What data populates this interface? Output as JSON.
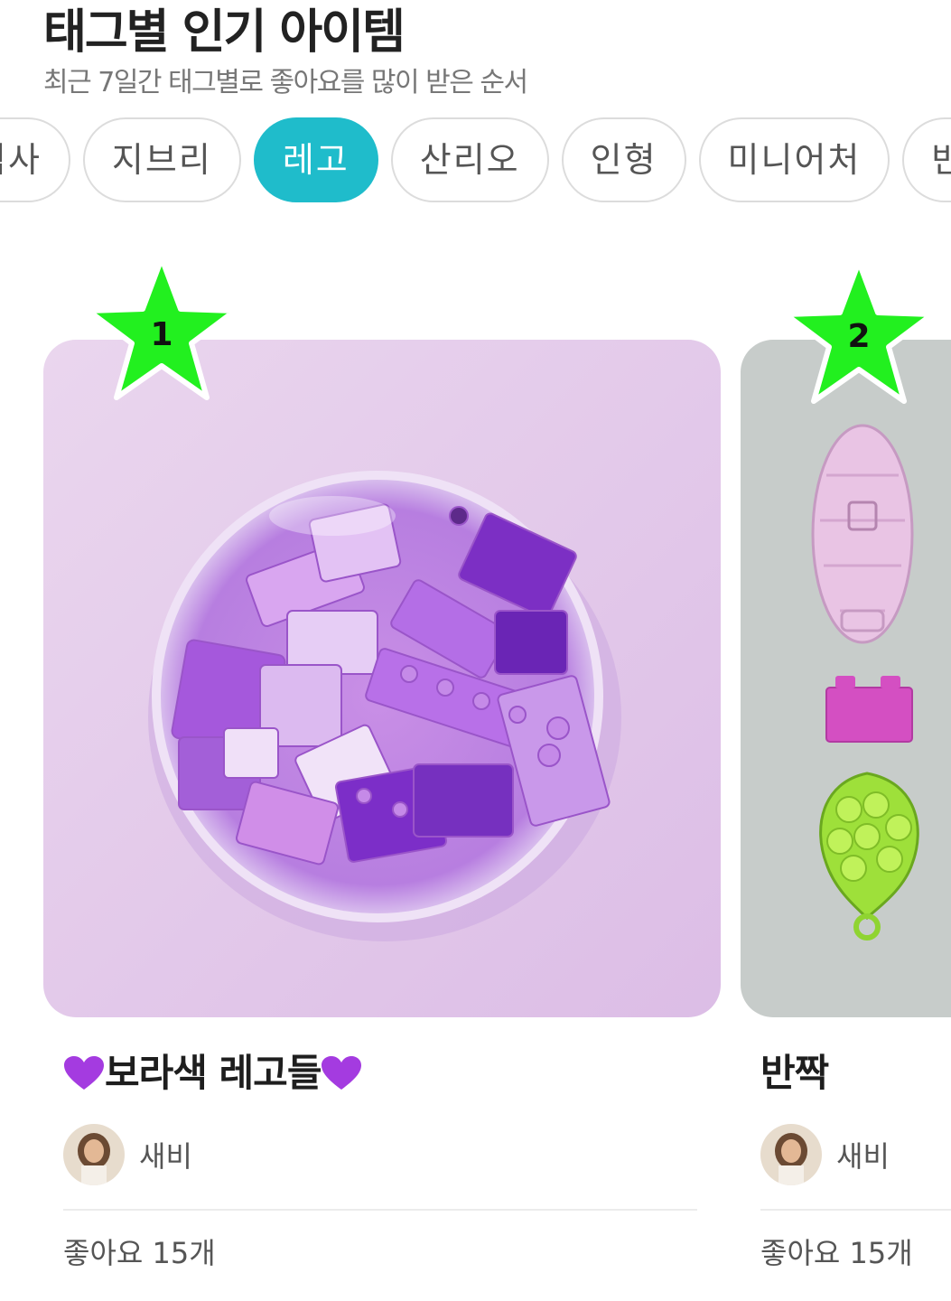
{
  "header": {
    "title": "태그별 인기 아이템",
    "subtitle": "최근 7일간 태그별로 좋아요를 많이 받은 순서"
  },
  "tabs": [
    {
      "label": "픽사",
      "active": false
    },
    {
      "label": "지브리",
      "active": false
    },
    {
      "label": "레고",
      "active": true
    },
    {
      "label": "산리오",
      "active": false
    },
    {
      "label": "인형",
      "active": false
    },
    {
      "label": "미니어처",
      "active": false
    },
    {
      "label": "반",
      "active": false
    }
  ],
  "cards": [
    {
      "rank": "1",
      "title": "보라색 레고들",
      "author": "새비",
      "likes": "좋아요 15개"
    },
    {
      "rank": "2",
      "title": "반짝",
      "author": "새비",
      "likes": "좋아요 15개"
    }
  ],
  "colors": {
    "accent": "#1fbccb",
    "star": "#22f01f",
    "heart": "#a43be0"
  }
}
